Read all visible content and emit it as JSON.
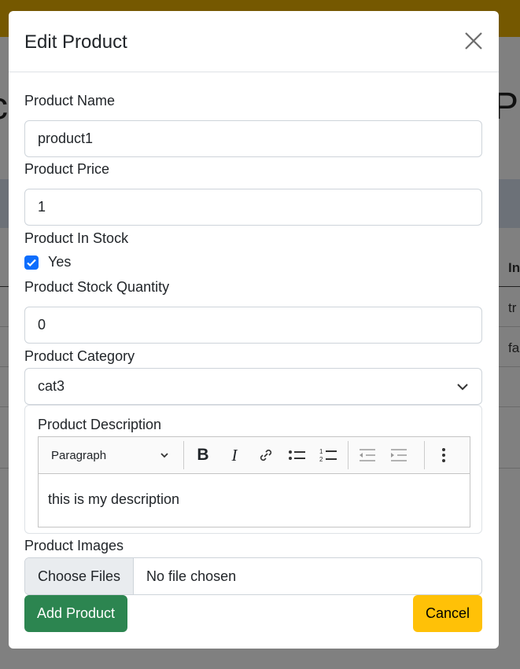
{
  "background": {
    "left_text": "c",
    "right_text": "Pa",
    "table_header": "In",
    "cells": [
      "tr",
      "fa"
    ]
  },
  "modal": {
    "title": "Edit Product",
    "fields": {
      "name_label": "Product Name",
      "name_value": "product1",
      "price_label": "Product Price",
      "price_value": "1",
      "stock_label": "Product In Stock",
      "stock_checked": true,
      "stock_check_label": "Yes",
      "qty_label": "Product Stock Quantity",
      "qty_value": "0",
      "category_label": "Product Category",
      "category_value": "cat3",
      "desc_label": "Product Description",
      "editor": {
        "format": "Paragraph",
        "content": "this is my description"
      },
      "images_label": "Product Images",
      "choose_files": "Choose Files",
      "no_file": "No file chosen"
    },
    "add_button": "Add Product",
    "cancel_button": "Cancel",
    "colors": {
      "add": "#2c8550",
      "cancel": "#ffc107",
      "checkbox": "#0d6efd"
    }
  }
}
